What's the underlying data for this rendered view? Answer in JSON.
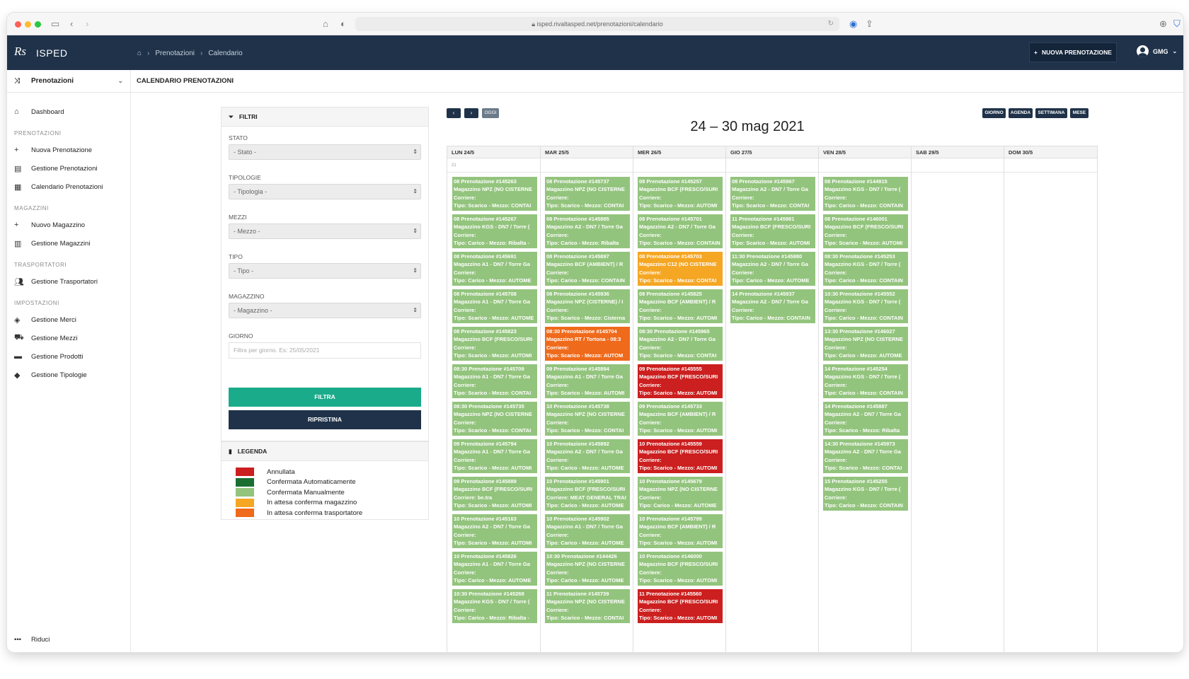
{
  "browser": {
    "url": "isped.rivaltasped.net/prenotazioni/calendario"
  },
  "app": {
    "logo": "Rs",
    "name": "ISPED",
    "breadcrumb": [
      "Prenotazioni",
      "Calendario"
    ],
    "new_booking_label": "NUOVA PRENOTAZIONE",
    "user": "GMG"
  },
  "sidebar": {
    "module": "Prenotazioni",
    "dashboard": "Dashboard",
    "sections": [
      {
        "title": "PRENOTAZIONI",
        "items": [
          {
            "label": "Nuova Prenotazione",
            "icon": "plus-icon"
          },
          {
            "label": "Gestione Prenotazioni",
            "icon": "list-icon"
          },
          {
            "label": "Calendario Prenotazioni",
            "icon": "calendar-icon"
          }
        ]
      },
      {
        "title": "MAGAZZINI",
        "items": [
          {
            "label": "Nuovo Magazzino",
            "icon": "plus-icon"
          },
          {
            "label": "Gestione Magazzini",
            "icon": "building-icon"
          }
        ]
      },
      {
        "title": "TRASPORTATORI",
        "items": [
          {
            "label": "Gestione Trasportatori",
            "icon": "users-icon"
          }
        ]
      },
      {
        "title": "IMPOSTAZIONI",
        "items": [
          {
            "label": "Gestione Merci",
            "icon": "box-icon"
          },
          {
            "label": "Gestione Mezzi",
            "icon": "truck-icon"
          },
          {
            "label": "Gestione Prodotti",
            "icon": "cart-icon"
          },
          {
            "label": "Gestione Tipologie",
            "icon": "tag-icon"
          }
        ]
      }
    ],
    "collapse_label": "Riduci"
  },
  "page": {
    "title": "CALENDARIO PRENOTAZIONI"
  },
  "filters": {
    "title": "FILTRI",
    "stato": {
      "label": "STATO",
      "value": "- Stato -"
    },
    "tipologie": {
      "label": "TIPOLOGIE",
      "value": "- Tipologia -"
    },
    "mezzi": {
      "label": "MEZZI",
      "value": "- Mezzo -"
    },
    "tipo": {
      "label": "TIPO",
      "value": "- Tipo -"
    },
    "magazzino": {
      "label": "MAGAZZINO",
      "value": "- Magazzino -"
    },
    "giorno": {
      "label": "GIORNO",
      "placeholder": "Filtra per giorno. Es: 25/05/2021"
    },
    "filter_button": "FILTRA",
    "reset_button": "RIPRISTINA"
  },
  "legend": {
    "title": "LEGENDA",
    "items": [
      {
        "label": "Annullata",
        "color": "#cc1f1f"
      },
      {
        "label": "Confermata Automaticamente",
        "color": "#1a6e32"
      },
      {
        "label": "Confermata Manualmente",
        "color": "#93c47d"
      },
      {
        "label": "In attesa conferma magazzino",
        "color": "#f5a623"
      },
      {
        "label": "In attesa conferma trasportatore",
        "color": "#ef6a1b"
      }
    ]
  },
  "calendar": {
    "title": "24 – 30 mag 2021",
    "today_label": "OGGI",
    "prev_icon": "chevron-left-icon",
    "next_icon": "chevron-right-icon",
    "views": [
      "GIORNO",
      "AGENDA",
      "SETTIMANA",
      "MESE"
    ],
    "week_number": "21",
    "days": [
      "LUN 24/5",
      "MAR 25/5",
      "MER 26/5",
      "GIO 27/5",
      "VEN 28/5",
      "SAB 29/5",
      "DOM 30/5"
    ],
    "colors": {
      "green": "#93c47d",
      "red": "#cc1f1f",
      "orange": "#f5a623",
      "dark_orange": "#ef6a1b"
    },
    "events": [
      [
        {
          "l1": "08 Prenotazione #145263",
          "l2": "Magazzino NPZ (NO CISTERNE",
          "l3": "Corriere:",
          "l4": "Tipo: Scarico - Mezzo: CONTAI",
          "color": "green"
        },
        {
          "l1": "08 Prenotazione #145267",
          "l2": "Magazzino KGS - DN7 / Torre (",
          "l3": "Corriere:",
          "l4": "Tipo: Carico - Mezzo: Ribalta -",
          "color": "green"
        },
        {
          "l1": "08 Prenotazione #145691",
          "l2": "Magazzino A1 - DN7 / Torre Ga",
          "l3": "Corriere:",
          "l4": "Tipo: Carico - Mezzo: AUTOME",
          "color": "green"
        },
        {
          "l1": "08 Prenotazione #145708",
          "l2": "Magazzino A1 - DN7 / Torre Ga",
          "l3": "Corriere:",
          "l4": "Tipo: Scarico - Mezzo: AUTOME",
          "color": "green"
        },
        {
          "l1": "08 Prenotazione #145823",
          "l2": "Magazzino BCF (FRESCO/SURI",
          "l3": "Corriere:",
          "l4": "Tipo: Scarico - Mezzo: AUTOMI",
          "color": "green"
        },
        {
          "l1": "08:30 Prenotazione #145709",
          "l2": "Magazzino A1 - DN7 / Torre Ga",
          "l3": "Corriere:",
          "l4": "Tipo: Scarico - Mezzo: CONTAI",
          "color": "green"
        },
        {
          "l1": "08:30 Prenotazione #145735",
          "l2": "Magazzino NPZ (NO CISTERNE",
          "l3": "Corriere:",
          "l4": "Tipo: Scarico - Mezzo: CONTAI",
          "color": "green"
        },
        {
          "l1": "09 Prenotazione #145794",
          "l2": "Magazzino A1 - DN7 / Torre Ga",
          "l3": "Corriere:",
          "l4": "Tipo: Scarico - Mezzo: AUTOMI",
          "color": "green"
        },
        {
          "l1": "09 Prenotazione #145889",
          "l2": "Magazzino BCF (FRESCO/SURI",
          "l3": "Corriere: be.tra",
          "l4": "Tipo: Scarico - Mezzo: AUTOMI",
          "color": "green"
        },
        {
          "l1": "10 Prenotazione #145163",
          "l2": "Magazzino A2 - DN7 / Torre Ga",
          "l3": "Corriere:",
          "l4": "Tipo: Scarico - Mezzo: AUTOMI",
          "color": "green"
        },
        {
          "l1": "10 Prenotazione #145826",
          "l2": "Magazzino A1 - DN7 / Torre Ga",
          "l3": "Corriere:",
          "l4": "Tipo: Carico - Mezzo: AUTOME",
          "color": "green"
        },
        {
          "l1": "10:30 Prenotazione #145268",
          "l2": "Magazzino KGS - DN7 / Torre (",
          "l3": "Corriere:",
          "l4": "Tipo: Carico - Mezzo: Ribalta -",
          "color": "green"
        }
      ],
      [
        {
          "l1": "08 Prenotazione #145737",
          "l2": "Magazzino NPZ (NO CISTERNE",
          "l3": "Corriere:",
          "l4": "Tipo: Scarico - Mezzo: CONTAI",
          "color": "green"
        },
        {
          "l1": "08 Prenotazione #145885",
          "l2": "Magazzino A2 - DN7 / Torre Ga",
          "l3": "Corriere:",
          "l4": "Tipo: Carico - Mezzo: Ribalta",
          "color": "green"
        },
        {
          "l1": "08 Prenotazione #145897",
          "l2": "Magazzino BCF (AMBIENT) / R",
          "l3": "Corriere:",
          "l4": "Tipo: Carico - Mezzo: CONTAIN",
          "color": "green"
        },
        {
          "l1": "08 Prenotazione #145936",
          "l2": "Magazzino NPZ (CISTERNE) / I",
          "l3": "Corriere:",
          "l4": "Tipo: Scarico - Mezzo: Cisterna",
          "color": "green"
        },
        {
          "l1": "08:30 Prenotazione #145704",
          "l2": "Magazzino RT / Tortona - 08:3",
          "l3": "Corriere:",
          "l4": "Tipo: Scarico - Mezzo: AUTOM",
          "color": "dark_orange"
        },
        {
          "l1": "09 Prenotazione #145894",
          "l2": "Magazzino A1 - DN7 / Torre Ga",
          "l3": "Corriere:",
          "l4": "Tipo: Scarico - Mezzo: AUTOMI",
          "color": "green"
        },
        {
          "l1": "10 Prenotazione #145738",
          "l2": "Magazzino NPZ (NO CISTERNE",
          "l3": "Corriere:",
          "l4": "Tipo: Scarico - Mezzo: CONTAI",
          "color": "green"
        },
        {
          "l1": "10 Prenotazione #145892",
          "l2": "Magazzino A2 - DN7 / Torre Ga",
          "l3": "Corriere:",
          "l4": "Tipo: Carico - Mezzo: AUTOME",
          "color": "green"
        },
        {
          "l1": "10 Prenotazione #145901",
          "l2": "Magazzino BCF (FRESCO/SURI",
          "l3": "Corriere: MEAT GENERAL TRAI",
          "l4": "Tipo: Carico - Mezzo: AUTOME",
          "color": "green"
        },
        {
          "l1": "10 Prenotazione #145902",
          "l2": "Magazzino A1 - DN7 / Torre Ga",
          "l3": "Corriere:",
          "l4": "Tipo: Carico - Mezzo: AUTOME",
          "color": "green"
        },
        {
          "l1": "10:30 Prenotazione #144426",
          "l2": "Magazzino NPZ (NO CISTERNE",
          "l3": "Corriere:",
          "l4": "Tipo: Carico - Mezzo: AUTOME",
          "color": "green"
        },
        {
          "l1": "11 Prenotazione #145739",
          "l2": "Magazzino NPZ (NO CISTERNE",
          "l3": "Corriere:",
          "l4": "Tipo: Scarico - Mezzo: CONTAI",
          "color": "green"
        }
      ],
      [
        {
          "l1": "08 Prenotazione #145257",
          "l2": "Magazzino BCF (FRESCO/SURI",
          "l3": "Corriere:",
          "l4": "Tipo: Scarico - Mezzo: AUTOMI",
          "color": "green"
        },
        {
          "l1": "08 Prenotazione #145701",
          "l2": "Magazzino A2 - DN7 / Torre Ga",
          "l3": "Corriere:",
          "l4": "Tipo: Scarico - Mezzo: CONTAIN",
          "color": "green"
        },
        {
          "l1": "08 Prenotazione #145703",
          "l2": "Magazzino C12 (NO CISTERNE",
          "l3": "Corriere:",
          "l4": "Tipo: Scarico - Mezzo: CONTAI",
          "color": "orange"
        },
        {
          "l1": "08 Prenotazione #145825",
          "l2": "Magazzino BCF (AMBIENT) / R",
          "l3": "Corriere:",
          "l4": "Tipo: Scarico - Mezzo: AUTOMI",
          "color": "green"
        },
        {
          "l1": "08:30 Prenotazione #145965",
          "l2": "Magazzino A2 - DN7 / Torre Ga",
          "l3": "Corriere:",
          "l4": "Tipo: Scarico - Mezzo: CONTAI",
          "color": "green"
        },
        {
          "l1": "09 Prenotazione #145555",
          "l2": "Magazzino BCF (FRESCO/SURI",
          "l3": "Corriere:",
          "l4": "Tipo: Scarico - Mezzo: AUTOMI",
          "color": "red"
        },
        {
          "l1": "09 Prenotazione #145733",
          "l2": "Magazzino BCF (AMBIENT) / R",
          "l3": "Corriere:",
          "l4": "Tipo: Scarico - Mezzo: AUTOMI",
          "color": "green"
        },
        {
          "l1": "10 Prenotazione #145559",
          "l2": "Magazzino BCF (FRESCO/SURI",
          "l3": "Corriere:",
          "l4": "Tipo: Scarico - Mezzo: AUTOMI",
          "color": "red"
        },
        {
          "l1": "10 Prenotazione #145679",
          "l2": "Magazzino NPZ (NO CISTERNE",
          "l3": "Corriere:",
          "l4": "Tipo: Carico - Mezzo: AUTOME",
          "color": "green"
        },
        {
          "l1": "10 Prenotazione #145799",
          "l2": "Magazzino BCF (AMBIENT) / R",
          "l3": "Corriere:",
          "l4": "Tipo: Scarico - Mezzo: AUTOMI",
          "color": "green"
        },
        {
          "l1": "10 Prenotazione #146000",
          "l2": "Magazzino BCF (FRESCO/SURI",
          "l3": "Corriere:",
          "l4": "Tipo: Scarico - Mezzo: AUTOMI",
          "color": "green"
        },
        {
          "l1": "11 Prenotazione #145560",
          "l2": "Magazzino BCF (FRESCO/SURI",
          "l3": "Corriere:",
          "l4": "Tipo: Scarico - Mezzo: AUTOMI",
          "color": "red"
        }
      ],
      [
        {
          "l1": "08 Prenotazione #145967",
          "l2": "Magazzino A2 - DN7 / Torre Ga",
          "l3": "Corriere:",
          "l4": "Tipo: Scarico - Mezzo: CONTAI",
          "color": "green"
        },
        {
          "l1": "11 Prenotazione #145981",
          "l2": "Magazzino BCF (FRESCO/SURI",
          "l3": "Corriere:",
          "l4": "Tipo: Scarico - Mezzo: AUTOMI",
          "color": "green"
        },
        {
          "l1": "11:30 Prenotazione #145880",
          "l2": "Magazzino A2 - DN7 / Torre Ga",
          "l3": "Corriere:",
          "l4": "Tipo: Carico - Mezzo: AUTOME",
          "color": "green"
        },
        {
          "l1": "14 Prenotazione #145937",
          "l2": "Magazzino A2 - DN7 / Torre Ga",
          "l3": "Corriere:",
          "l4": "Tipo: Carico - Mezzo: CONTAIN",
          "color": "green"
        }
      ],
      [
        {
          "l1": "08 Prenotazione #144915",
          "l2": "Magazzino KGS - DN7 / Torre (",
          "l3": "Corriere:",
          "l4": "Tipo: Carico - Mezzo: CONTAIN",
          "color": "green"
        },
        {
          "l1": "08 Prenotazione #146001",
          "l2": "Magazzino BCF (FRESCO/SURI",
          "l3": "Corriere:",
          "l4": "Tipo: Scarico - Mezzo: AUTOMI",
          "color": "green"
        },
        {
          "l1": "08:30 Prenotazione #145253",
          "l2": "Magazzino KGS - DN7 / Torre (",
          "l3": "Corriere:",
          "l4": "Tipo: Carico - Mezzo: CONTAIN",
          "color": "green"
        },
        {
          "l1": "10:30 Prenotazione #145552",
          "l2": "Magazzino KGS - DN7 / Torre (",
          "l3": "Corriere:",
          "l4": "Tipo: Carico - Mezzo: CONTAIN",
          "color": "green"
        },
        {
          "l1": "13:30 Prenotazione #146027",
          "l2": "Magazzino NPZ (NO CISTERNE",
          "l3": "Corriere:",
          "l4": "Tipo: Carico - Mezzo: AUTOME",
          "color": "green"
        },
        {
          "l1": "14 Prenotazione #145254",
          "l2": "Magazzino KGS - DN7 / Torre (",
          "l3": "Corriere:",
          "l4": "Tipo: Carico - Mezzo: CONTAIN",
          "color": "green"
        },
        {
          "l1": "14 Prenotazione #145887",
          "l2": "Magazzino A2 - DN7 / Torre Ga",
          "l3": "Corriere:",
          "l4": "Tipo: Scarico - Mezzo: Ribalta",
          "color": "green"
        },
        {
          "l1": "14:30 Prenotazione #145973",
          "l2": "Magazzino A2 - DN7 / Torre Ga",
          "l3": "Corriere:",
          "l4": "Tipo: Scarico - Mezzo: CONTAI",
          "color": "green"
        },
        {
          "l1": "15 Prenotazione #145255",
          "l2": "Magazzino KGS - DN7 / Torre (",
          "l3": "Corriere:",
          "l4": "Tipo: Carico - Mezzo: CONTAIN",
          "color": "green"
        }
      ],
      [],
      []
    ]
  }
}
